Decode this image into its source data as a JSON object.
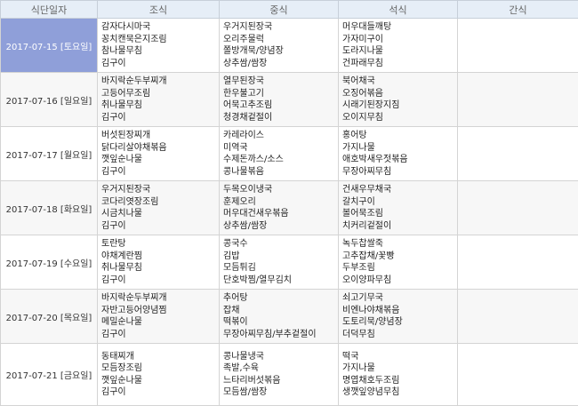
{
  "header": {
    "date": "식단일자",
    "breakfast": "조식",
    "lunch": "중식",
    "dinner": "석식",
    "snack": "간식"
  },
  "days": [
    {
      "date": "2017-07-15 [토요일]",
      "selected": true,
      "breakfast": [
        "감자다시마국",
        "꽁치캔묵은지조림",
        "참나물무침",
        "김구이"
      ],
      "lunch": [
        "우거지된장국",
        "오리주물럭",
        "쫄방개묵/양념장",
        "상추쌈/쌈장"
      ],
      "dinner": [
        "머우대들깨탕",
        "가자미구이",
        "도라지나물",
        "건파래무침"
      ],
      "snack": ""
    },
    {
      "date": "2017-07-16 [일요일]",
      "selected": false,
      "breakfast": [
        "바지락순두부찌개",
        "고등어무조림",
        "취나물무침",
        "김구이"
      ],
      "lunch": [
        "열무된장국",
        "한우불고기",
        "어묵고추조림",
        "청경채겉절이"
      ],
      "dinner": [
        "북어채국",
        "오징어볶음",
        "시래기된장지짐",
        "오이지무침"
      ],
      "snack": ""
    },
    {
      "date": "2017-07-17 [월요일]",
      "selected": false,
      "breakfast": [
        "버섯된장찌개",
        "닭다리살야채볶음",
        "깻잎순나물",
        "김구이"
      ],
      "lunch": [
        "카레라이스",
        "미역국",
        "수제돈까스/소스",
        "콩나물볶음"
      ],
      "dinner": [
        "홍어탕",
        "가지나물",
        "애호박새우젓볶음",
        "무장아찌무침"
      ],
      "snack": ""
    },
    {
      "date": "2017-07-18 [화요일]",
      "selected": false,
      "breakfast": [
        "우거지된장국",
        "코다리엿장조림",
        "시금치나물",
        "김구이"
      ],
      "lunch": [
        "두목오이냉국",
        "훈제오리",
        "머우대건새우볶음",
        "상추쌈/쌈장"
      ],
      "dinner": [
        "건새우무채국",
        "갈치구이",
        "볼어묵조림",
        "치커리겉절이"
      ],
      "snack": ""
    },
    {
      "date": "2017-07-19 [수요일]",
      "selected": false,
      "breakfast": [
        "토란탕",
        "야채계란찜",
        "취나물무침",
        "김구이"
      ],
      "lunch": [
        "콩국수",
        "김밥",
        "모듬튀김",
        "단호박찜/열무김치"
      ],
      "dinner": [
        "녹두찹쌀죽",
        "고추잡채/꽃빵",
        "두부조림",
        "오이양파무침"
      ],
      "snack": ""
    },
    {
      "date": "2017-07-20 [목요일]",
      "selected": false,
      "breakfast": [
        "바지락순두부찌개",
        "자반고등어양념찜",
        "메밀순나물",
        "김구이"
      ],
      "lunch": [
        "추어탕",
        "잡채",
        "떡볶이",
        "무장아찌무침/부추겉절이"
      ],
      "dinner": [
        "쇠고기무국",
        "비엔나야채볶음",
        "도토리묵/양념장",
        "더덕무침"
      ],
      "snack": ""
    },
    {
      "date": "2017-07-21 [금요일]",
      "selected": false,
      "breakfast": [
        "동태찌개",
        "모듬장조림",
        "깻잎순나물",
        "김구이"
      ],
      "lunch": [
        "콩나물냉국",
        "족발,수육",
        "느타리버섯볶음",
        "모듬쌈/쌈장"
      ],
      "dinner": [
        "떡국",
        "가지나물",
        "명엽채호두조림",
        "생깻잎양념무침"
      ],
      "snack": ""
    }
  ]
}
